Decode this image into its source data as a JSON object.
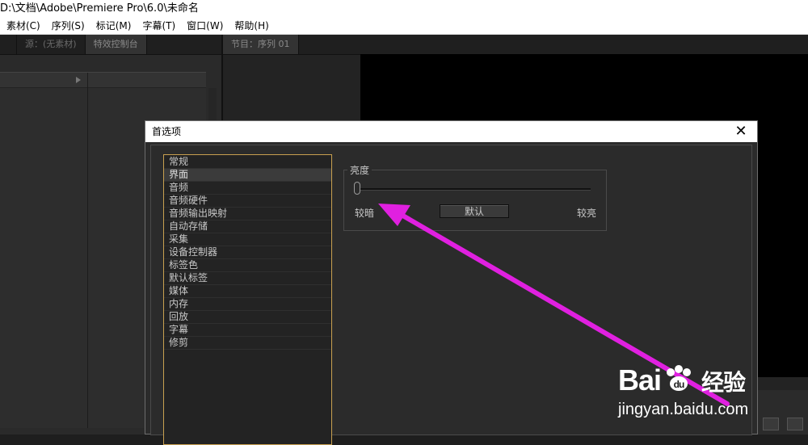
{
  "window": {
    "title": "D:\\文档\\Adobe\\Premiere Pro\\6.0\\未命名"
  },
  "menu": {
    "items": [
      "素材(C)",
      "序列(S)",
      "标记(M)",
      "字幕(T)",
      "窗口(W)",
      "帮助(H)"
    ]
  },
  "panels": {
    "left_tabs": [
      "源：(无素材)",
      "特效控制台"
    ],
    "right_tabs": [
      "节目：序列 01"
    ]
  },
  "dialog": {
    "title": "首选项",
    "close_glyph": "✕",
    "categories": [
      "常规",
      "界面",
      "音频",
      "音频硬件",
      "音频输出映射",
      "自动存储",
      "采集",
      "设备控制器",
      "标签色",
      "默认标签",
      "媒体",
      "内存",
      "回放",
      "字幕",
      "修剪"
    ],
    "selected_index": 1,
    "brightness": {
      "group_label": "亮度",
      "min_label": "较暗",
      "max_label": "较亮",
      "default_button": "默认",
      "value": 0
    }
  },
  "annotation": {
    "color": "#e020e0"
  },
  "watermark": {
    "brand": "Bai",
    "brand_cn": "经验",
    "url": "jingyan.baidu.com"
  }
}
